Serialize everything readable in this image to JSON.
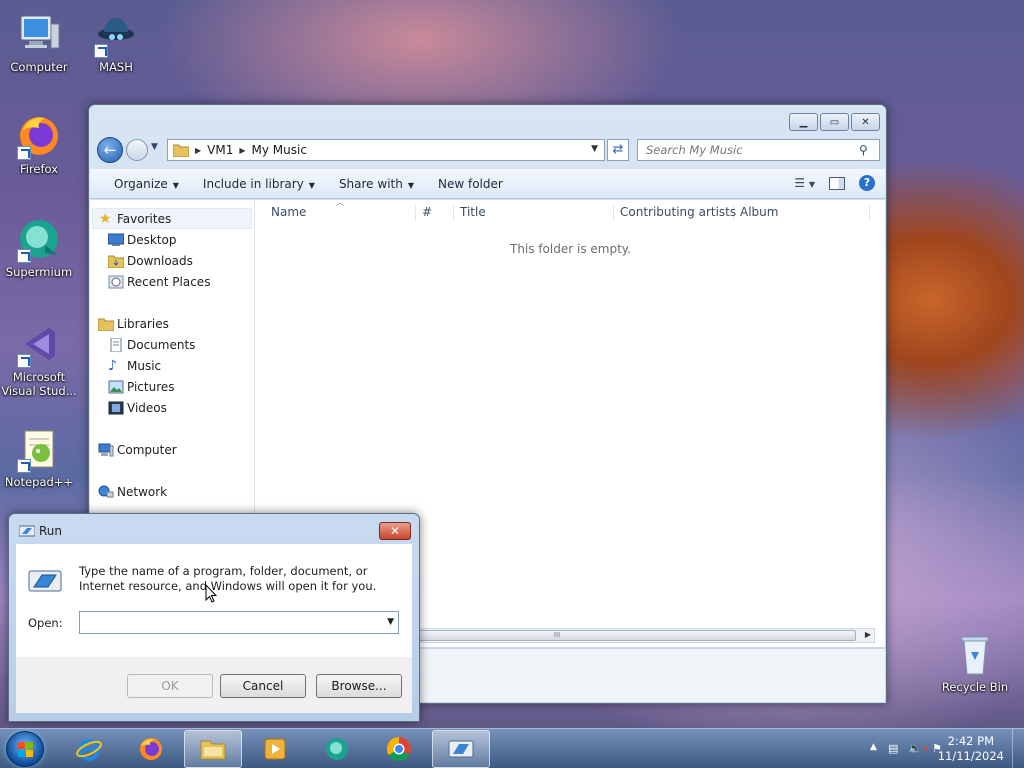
{
  "desktop": {
    "icons": [
      {
        "label": "Computer"
      },
      {
        "label": "MASH"
      },
      {
        "label": "Firefox"
      },
      {
        "label": "Supermium"
      },
      {
        "label": "Microsoft Visual Stud..."
      },
      {
        "label": "Notepad++"
      },
      {
        "label": "Recycle Bin"
      }
    ]
  },
  "explorer": {
    "breadcrumb": [
      "VM1",
      "My Music"
    ],
    "search_placeholder": "Search My Music",
    "commands": [
      "Organize",
      "Include in library",
      "Share with",
      "New folder"
    ],
    "nav": {
      "favorites": {
        "label": "Favorites",
        "items": [
          "Desktop",
          "Downloads",
          "Recent Places"
        ]
      },
      "libraries": {
        "label": "Libraries",
        "items": [
          "Documents",
          "Music",
          "Pictures",
          "Videos"
        ]
      },
      "computer": "Computer",
      "network": "Network"
    },
    "columns": [
      "Name",
      "#",
      "Title",
      "Contributing artists",
      "Album"
    ],
    "empty_message": "This folder is empty.",
    "scroll_grip": "III"
  },
  "run_dialog": {
    "title": "Run",
    "description": "Type the name of a program, folder, document, or Internet resource, and Windows will open it for you.",
    "open_label": "Open:",
    "open_value": "",
    "buttons": {
      "ok": "OK",
      "cancel": "Cancel",
      "browse": "Browse..."
    },
    "close_glyph": "✕"
  },
  "taskbar": {
    "clock_time": "2:42 PM",
    "clock_date": "11/11/2024",
    "tray_expand": "▲"
  },
  "colors": {
    "window_frame": "#c7d9ee",
    "close_button": "#c6452c",
    "taskbar": "#3c5a82",
    "accent": "#1f5fb2"
  }
}
